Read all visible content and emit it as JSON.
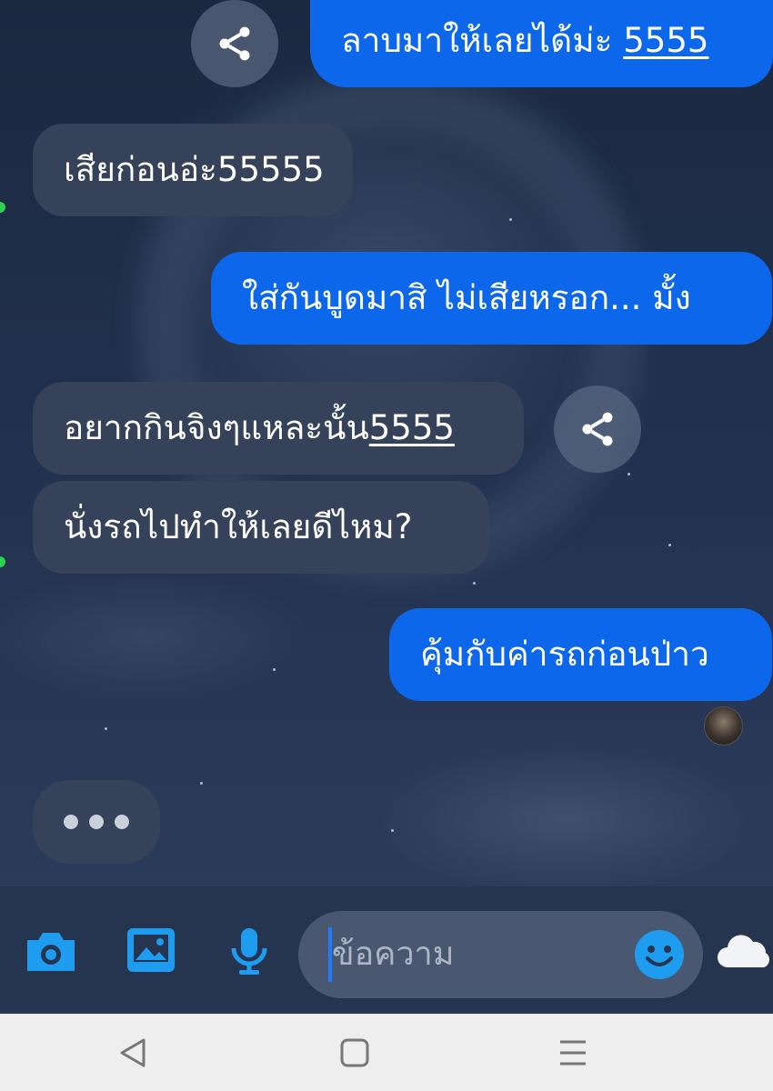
{
  "messages": [
    {
      "side": "out",
      "text": "ลาบมาให้เลยได้ม่ะ",
      "link": "5555"
    },
    {
      "side": "in",
      "text": "เสียก่อนอ่ะ55555"
    },
    {
      "side": "out",
      "text": "ใส่กันบูดมาสิ ไม่เสียหรอก... มั้ง"
    },
    {
      "side": "in",
      "text": "อยากกินจิงๆแหละนั้น",
      "link": "5555"
    },
    {
      "side": "in",
      "text": "นั่งรถไปทำให้เลยดีไหม?"
    },
    {
      "side": "out",
      "text": "คุ้มกับค่ารถก่อนป่าว"
    }
  ],
  "icons": {
    "share": "share-icon",
    "camera": "camera-icon",
    "gallery": "image-icon",
    "mic": "microphone-icon",
    "emoji": "smiley-icon",
    "weather": "cloud-icon",
    "nav_back": "back-triangle-icon",
    "nav_home": "home-square-icon",
    "nav_menu": "menu-lines-icon"
  },
  "composer": {
    "placeholder": "ข้อความ"
  },
  "colors": {
    "outgoing_bubble": "#0c67ea",
    "incoming_bubble": "#36425a",
    "accent_icon": "#1e9cf0",
    "online_dot": "#2fcf53"
  }
}
